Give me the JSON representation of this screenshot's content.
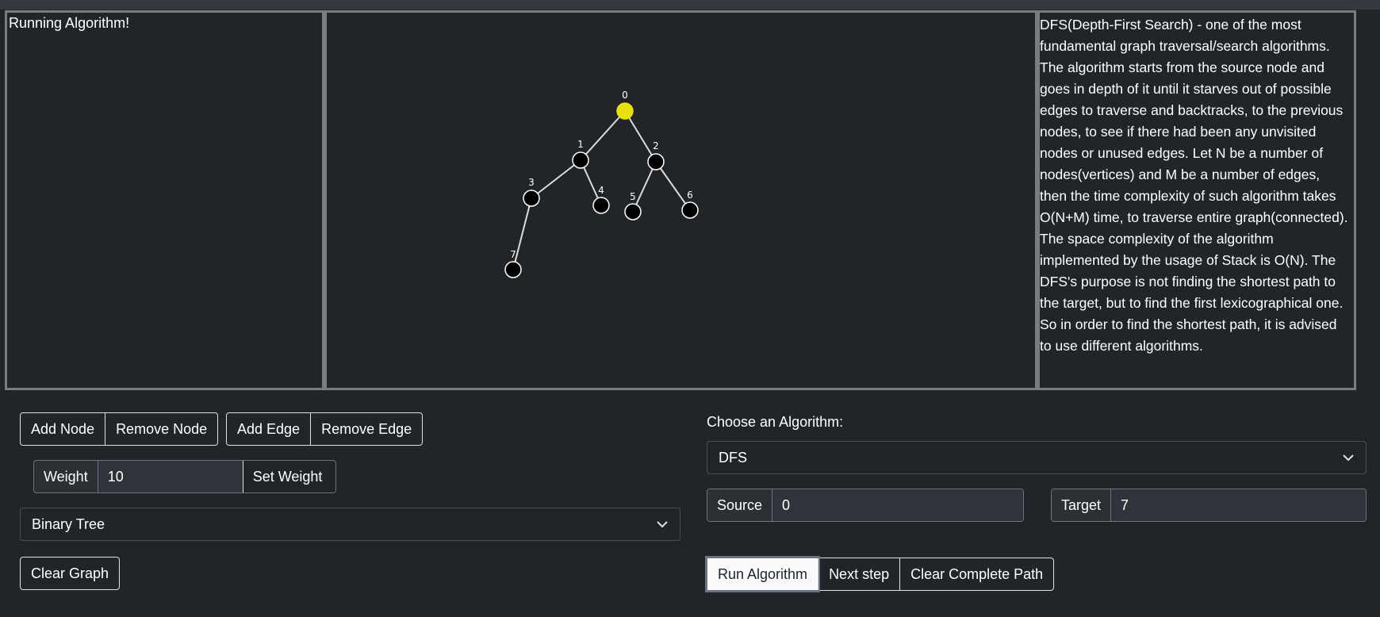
{
  "status": {
    "text": "Running Algorithm!"
  },
  "description": {
    "text": "DFS(Depth-First Search) - one of the most fundamental graph traversal/search algorithms. The algorithm starts from the source node and goes in depth of it until it starves out of possible edges to traverse and backtracks, to the previous nodes, to see if there had been any unvisited nodes or unused edges. Let N be a number of nodes(vertices) and M be a number of edges, then the time complexity of such algorithm takes O(N+M) time, to traverse entire graph(connected). The space complexity of the algorithm implemented by the usage of Stack is O(N). The DFS's purpose is not finding the shortest path to the target, but to find the first lexicographical one. So in order to find the shortest path, it is advised to use different algorithms."
  },
  "graph": {
    "highlight_color": "#e8e011",
    "node_color": "#000000",
    "nodes": [
      {
        "label": "0",
        "highlighted": true
      },
      {
        "label": "1",
        "highlighted": false
      },
      {
        "label": "2",
        "highlighted": false
      },
      {
        "label": "3",
        "highlighted": false
      },
      {
        "label": "4",
        "highlighted": false
      },
      {
        "label": "5",
        "highlighted": false
      },
      {
        "label": "6",
        "highlighted": false
      },
      {
        "label": "7",
        "highlighted": false
      }
    ],
    "edges": [
      [
        "0",
        "1"
      ],
      [
        "0",
        "2"
      ],
      [
        "1",
        "3"
      ],
      [
        "1",
        "4"
      ],
      [
        "2",
        "5"
      ],
      [
        "2",
        "6"
      ],
      [
        "3",
        "7"
      ]
    ]
  },
  "toolbar": {
    "add_node": "Add Node",
    "remove_node": "Remove Node",
    "add_edge": "Add Edge",
    "remove_edge": "Remove Edge",
    "weight_label": "Weight",
    "weight_value": "10",
    "set_weight": "Set Weight",
    "graph_type": "Binary Tree",
    "clear_graph": "Clear Graph"
  },
  "algorithm": {
    "choose_label": "Choose an Algorithm:",
    "selected": "DFS",
    "source_label": "Source",
    "source_value": "0",
    "target_label": "Target",
    "target_value": "7",
    "run": "Run Algorithm",
    "next_step": "Next step",
    "clear_path": "Clear Complete Path"
  }
}
